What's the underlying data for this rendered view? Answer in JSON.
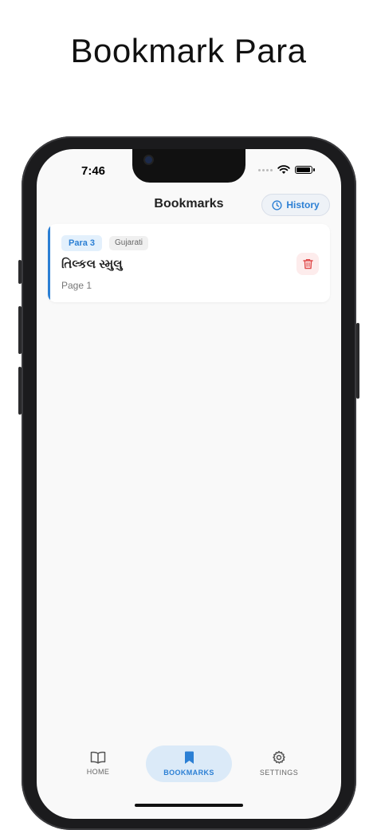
{
  "promo": {
    "title": "Bookmark Para"
  },
  "status_bar": {
    "time": "7:46"
  },
  "header": {
    "title": "Bookmarks",
    "history_label": "History"
  },
  "bookmarks": [
    {
      "para": "Para 3",
      "language": "Gujarati",
      "title": "તિલ્કલ સ્મુલુ",
      "page": "Page 1"
    }
  ],
  "tabs": [
    {
      "label": "HOME",
      "icon": "book-open-icon"
    },
    {
      "label": "BOOKMARKS",
      "icon": "bookmark-icon",
      "active": true
    },
    {
      "label": "SETTINGS",
      "icon": "gear-icon"
    }
  ],
  "colors": {
    "accent": "#2b7fd4",
    "danger": "#e04a4a",
    "background": "#f9f9f9"
  }
}
